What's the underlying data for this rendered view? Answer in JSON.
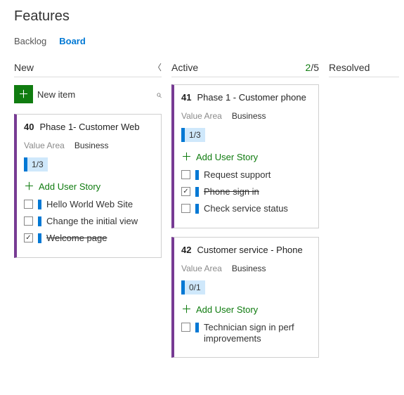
{
  "page_title": "Features",
  "tabs": {
    "backlog": "Backlog",
    "board": "Board"
  },
  "columns": {
    "new": {
      "title": "New"
    },
    "active": {
      "title": "Active",
      "wip_count": "2",
      "wip_limit": "/5"
    },
    "resolved": {
      "title": "Resolved"
    }
  },
  "newitem_label": "New item",
  "add_story_label": "Add User Story",
  "field_value_area": "Value Area",
  "cards": {
    "c40": {
      "id": "40",
      "title": "Phase 1- Customer Web",
      "value_area": "Business",
      "progress": "1/3",
      "stories": [
        {
          "label": "Hello World Web Site",
          "done": false
        },
        {
          "label": "Change the initial view",
          "done": false
        },
        {
          "label": "Welcome page",
          "done": true
        }
      ]
    },
    "c41": {
      "id": "41",
      "title": "Phase 1 - Customer phone",
      "value_area": "Business",
      "progress": "1/3",
      "stories": [
        {
          "label": "Request support",
          "done": false
        },
        {
          "label": "Phone sign in",
          "done": true
        },
        {
          "label": "Check service status",
          "done": false
        }
      ]
    },
    "c42": {
      "id": "42",
      "title": "Customer service - Phone",
      "value_area": "Business",
      "progress": "0/1",
      "stories": [
        {
          "label": "Technician sign in perf improvements",
          "done": false
        }
      ]
    }
  }
}
